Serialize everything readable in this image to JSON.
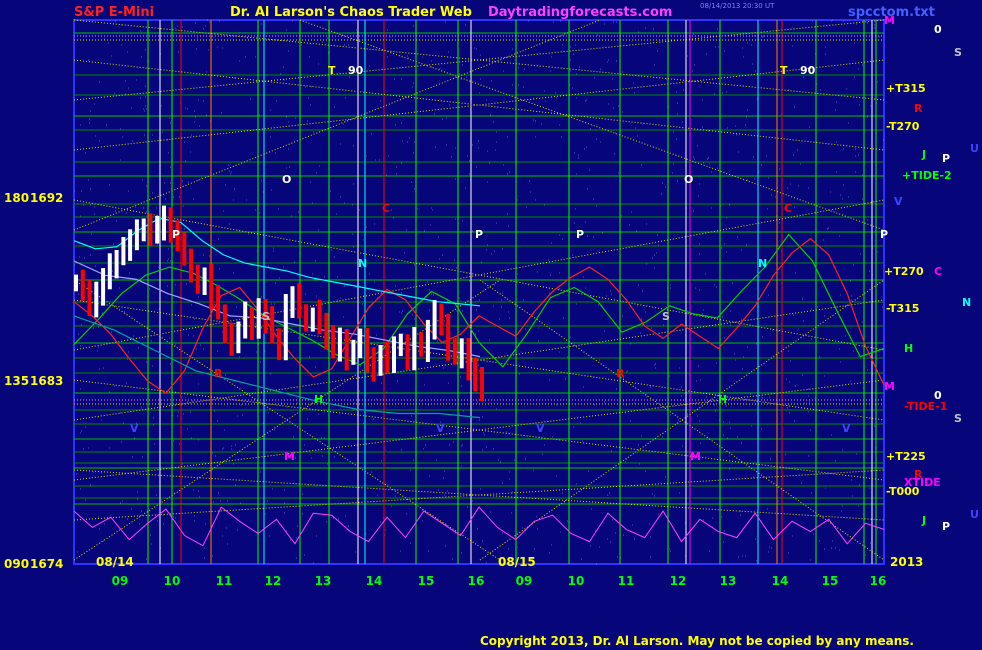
{
  "header": {
    "symbol": "S&P E-Mini",
    "title": "Dr. Al Larson's Chaos Trader Web",
    "site": "Daytradingforecasts.com",
    "timestamp": "08/14/2013 20:30 UT",
    "file": "spcctom.txt"
  },
  "footer": {
    "copyright": "Copyright 2013, Dr. Al Larson. May not be copied by any means."
  },
  "colors": {
    "background": "#06067a",
    "price_up": "#ffffff",
    "price_down": "#ff0000",
    "grid": "#00aa00"
  },
  "chart_data": {
    "type": "line",
    "y_axis_labels": [
      {
        "angle": "180",
        "price": "1692"
      },
      {
        "angle": "135",
        "price": "1683"
      },
      {
        "angle": "090",
        "price": "1674"
      }
    ],
    "ylim": [
      1674,
      1692
    ],
    "x_ticks": [
      "09",
      "10",
      "11",
      "12",
      "13",
      "14",
      "15",
      "16",
      "09",
      "10",
      "11",
      "12",
      "13",
      "14",
      "15",
      "16"
    ],
    "date_labels": [
      "08/14",
      "08/15"
    ],
    "year_label": "2013",
    "right_labels": [
      {
        "text": "M",
        "color": "#ff00ff"
      },
      {
        "text": "0",
        "color": "#ffffff"
      },
      {
        "text": "S",
        "color": "#c0c0c0"
      },
      {
        "text": "+T315",
        "color": "#ffff00"
      },
      {
        "text": "R",
        "color": "#ff0000"
      },
      {
        "text": "-T270",
        "color": "#ffff00"
      },
      {
        "text": "U",
        "color": "#4040ff"
      },
      {
        "text": "J",
        "color": "#00ff00"
      },
      {
        "text": "P",
        "color": "#ffffff"
      },
      {
        "text": "+TIDE-2",
        "color": "#00ff00"
      },
      {
        "text": "V",
        "color": "#4040ff"
      },
      {
        "text": "C",
        "color": "#ff00ff"
      },
      {
        "text": "+T270",
        "color": "#ffff00"
      },
      {
        "text": "N",
        "color": "#00ffff"
      },
      {
        "text": "-T315",
        "color": "#ffff00"
      },
      {
        "text": "H",
        "color": "#00ff00"
      },
      {
        "text": "M",
        "color": "#ff00ff"
      },
      {
        "text": "0",
        "color": "#ffffff"
      },
      {
        "text": "-TIDE-1",
        "color": "#ff0000"
      },
      {
        "text": "S",
        "color": "#c0c0c0"
      },
      {
        "text": "+T225",
        "color": "#ffff00"
      },
      {
        "text": "R",
        "color": "#ff0000"
      },
      {
        "text": "XTIDE",
        "color": "#ff00ff"
      },
      {
        "text": "-T000",
        "color": "#ffff00"
      },
      {
        "text": "U",
        "color": "#4040ff"
      },
      {
        "text": "J",
        "color": "#00ff00"
      },
      {
        "text": "P",
        "color": "#ffffff"
      }
    ],
    "in_chart_labels": [
      {
        "text": "T",
        "color": "#ffff00"
      },
      {
        "text": "90",
        "color": "#ffffff"
      },
      {
        "text": "T",
        "color": "#ffff00"
      },
      {
        "text": "90",
        "color": "#ffffff"
      },
      {
        "text": "O",
        "color": "#ffffff"
      },
      {
        "text": "O",
        "color": "#ffffff"
      },
      {
        "text": "P",
        "color": "#ffffff"
      },
      {
        "text": "P",
        "color": "#ffffff"
      },
      {
        "text": "P",
        "color": "#ffffff"
      },
      {
        "text": "P",
        "color": "#ffffff"
      },
      {
        "text": "C",
        "color": "#ff0000"
      },
      {
        "text": "C",
        "color": "#ff0000"
      },
      {
        "text": "N",
        "color": "#00ffff"
      },
      {
        "text": "N",
        "color": "#00ffff"
      },
      {
        "text": "S",
        "color": "#c0c0c0"
      },
      {
        "text": "S",
        "color": "#c0c0c0"
      },
      {
        "text": "R",
        "color": "#ff0000"
      },
      {
        "text": "R",
        "color": "#ff0000"
      },
      {
        "text": "H",
        "color": "#00ff00"
      },
      {
        "text": "H",
        "color": "#00ff00"
      },
      {
        "text": "M",
        "color": "#ff00ff"
      },
      {
        "text": "M",
        "color": "#ff00ff"
      },
      {
        "text": "V",
        "color": "#4040ff"
      },
      {
        "text": "V",
        "color": "#4040ff"
      },
      {
        "text": "V",
        "color": "#4040ff"
      },
      {
        "text": "V",
        "color": "#4040ff"
      }
    ],
    "price_series": {
      "name": "",
      "values": [
        1687.8,
        1687.4,
        1686.6,
        1687.2,
        1688.1,
        1688.6,
        1689.0,
        1689.5,
        1689.8,
        1690.3,
        1690.6,
        1690.2,
        1690.5,
        1691.2,
        1690.4,
        1689.9,
        1689.2,
        1688.3,
        1687.6,
        1688.1,
        1687.2,
        1686.4,
        1685.5,
        1684.8,
        1685.4,
        1686.3,
        1685.7,
        1686.5,
        1686.0,
        1685.2,
        1684.7,
        1686.6,
        1687.3,
        1686.4,
        1685.9,
        1686.3,
        1685.8,
        1685.1,
        1684.5,
        1685.0,
        1684.2,
        1684.7,
        1685.1,
        1684.0,
        1683.6,
        1684.4,
        1683.8,
        1684.6,
        1684.9,
        1684.2,
        1685.0,
        1684.6,
        1685.4,
        1686.4,
        1685.8,
        1684.6,
        1684.2,
        1684.5,
        1683.6,
        1683.0,
        1682.6
      ]
    },
    "series": [
      {
        "values": [
          1684.8,
          1686.0,
          1687.3,
          1688.2,
          1688.6,
          1688.3,
          1687.7,
          1687.0,
          1686.2,
          1685.6,
          1685.0,
          1684.3,
          1683.8,
          1684.6,
          1686.3,
          1687.4,
          1686.8,
          1684.9,
          1683.7,
          1685.3,
          1687.1,
          1687.6,
          1686.9,
          1685.4,
          1685.9,
          1686.7,
          1686.3,
          1686.1,
          1687.4,
          1688.6,
          1690.2,
          1688.9,
          1686.5,
          1684.2,
          1684.6
        ]
      },
      {
        "values": [
          1686.9,
          1686.2,
          1685.3,
          1684.1,
          1683.0,
          1682.4,
          1683.5,
          1685.6,
          1687.2,
          1687.6,
          1686.5,
          1685.2,
          1684.1,
          1683.2,
          1683.6,
          1685.1,
          1686.6,
          1687.5,
          1687.0,
          1685.8,
          1684.9,
          1685.3,
          1686.2,
          1685.7,
          1685.2,
          1686.4,
          1687.4,
          1688.1,
          1688.6,
          1688.0,
          1687.0,
          1685.7,
          1685.1,
          1685.8,
          1685.2,
          1684.6,
          1685.6,
          1686.7,
          1688.2,
          1689.3,
          1690.0,
          1689.2,
          1687.3,
          1684.7,
          1682.8
        ]
      },
      {
        "values": [
          1689.9,
          1689.5,
          1689.6,
          1690.4,
          1691.0,
          1690.8,
          1689.9,
          1689.2,
          1688.8,
          1688.6,
          1688.4,
          1688.1,
          1687.9,
          1687.7,
          1687.5,
          1687.3,
          1687.1,
          1686.9,
          1686.8,
          1686.7
        ]
      },
      {
        "values": [
          1688.9,
          1688.2,
          1688.0,
          1687.3,
          1686.8,
          1686.2,
          1686.1,
          1685.8,
          1685.5,
          1685.3,
          1685.0,
          1684.7,
          1684.5,
          1684.2
        ]
      },
      {
        "values": [
          1686.2,
          1685.5,
          1684.5,
          1683.5,
          1683.0,
          1682.5,
          1682.0,
          1681.6,
          1681.4,
          1681.4,
          1681.2
        ]
      },
      {
        "values": [
          1676.6,
          1675.8,
          1676.3,
          1675.2,
          1676.0,
          1676.7,
          1675.4,
          1674.9,
          1676.8,
          1676.1,
          1675.5,
          1676.2,
          1675.0,
          1676.5,
          1676.4,
          1675.6,
          1675.1,
          1676.3,
          1675.3,
          1676.6,
          1676.0,
          1675.4,
          1676.8,
          1675.8,
          1675.2,
          1676.1,
          1676.4,
          1675.5,
          1675.1,
          1676.5,
          1675.7,
          1675.3,
          1676.6,
          1675.1,
          1676.2,
          1675.6,
          1675.3,
          1676.5,
          1675.2,
          1676.1,
          1675.6,
          1676.2,
          1675.0,
          1676.0,
          1675.7
        ]
      }
    ]
  }
}
